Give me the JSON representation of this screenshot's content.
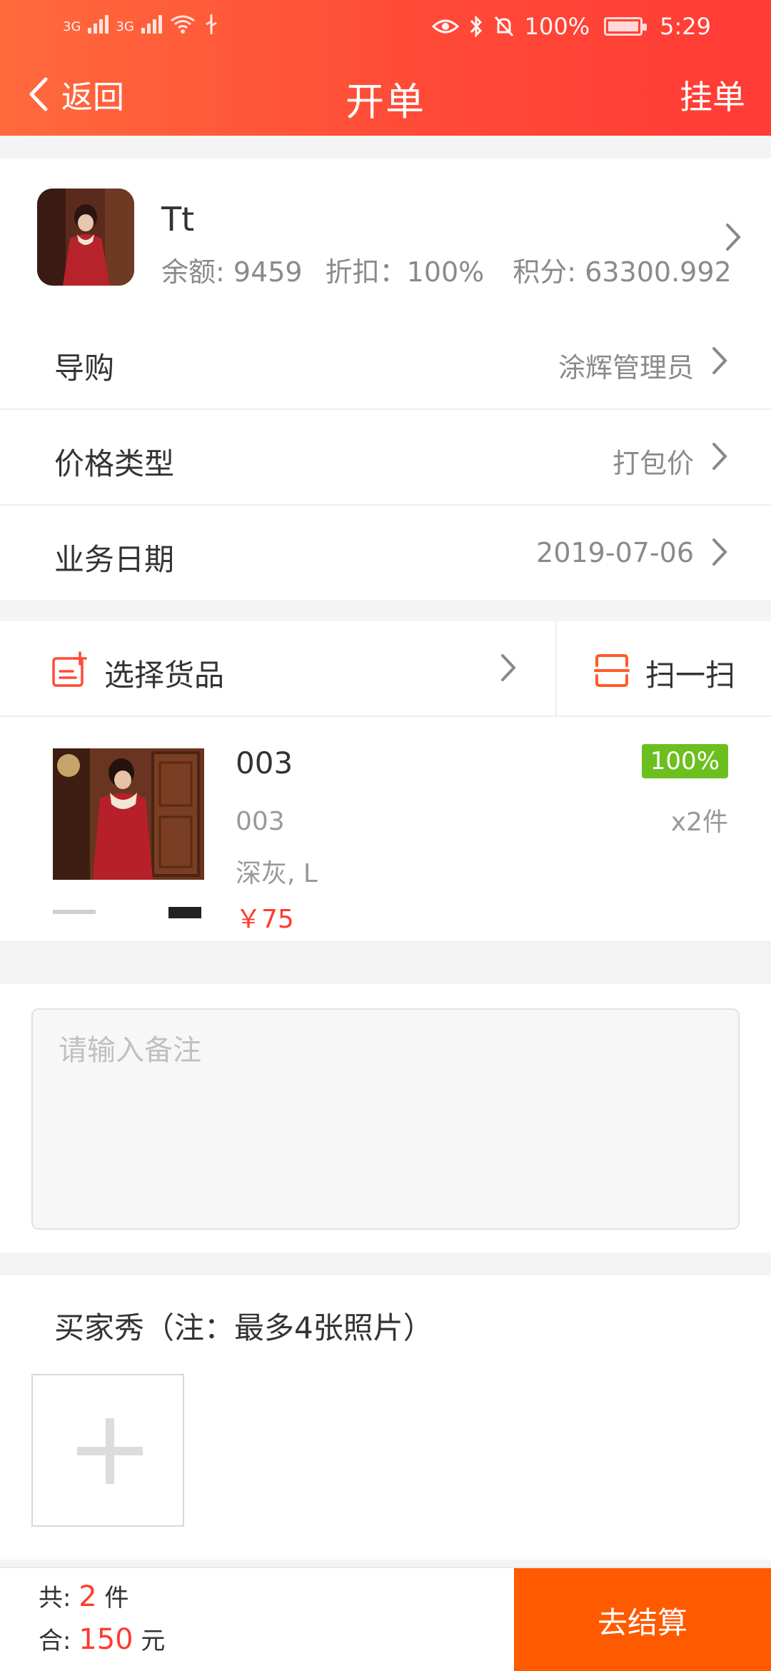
{
  "status_bar": {
    "network_1": "3G",
    "network_2": "3G",
    "battery_percent": "100%",
    "time": "5:29"
  },
  "nav": {
    "back_label": "返回",
    "title": "开单",
    "right_action": "挂单"
  },
  "customer": {
    "name": "Tt",
    "balance_label": "余额:",
    "balance_value": "9459",
    "discount_label": "折扣：",
    "discount_value": "100%",
    "points_label": "积分:",
    "points_value": "63300.992"
  },
  "fields": [
    {
      "label": "导购",
      "value": "涂辉管理员"
    },
    {
      "label": "价格类型",
      "value": "打包价"
    },
    {
      "label": "业务日期",
      "value": "2019-07-06"
    }
  ],
  "product_section": {
    "select_label": "选择货品",
    "scan_label": "扫一扫"
  },
  "product": {
    "name": "003",
    "code": "003",
    "spec": "深灰, L",
    "price": "￥75",
    "discount_badge": "100%",
    "qty": "x2件"
  },
  "remark": {
    "placeholder": "请输入备注"
  },
  "buyer_show": {
    "title": "买家秀（注：最多4张照片）"
  },
  "summary": {
    "count_prefix": "共: ",
    "count_value": "2",
    "count_suffix": " 件",
    "total_prefix": "合: ",
    "total_value": "150",
    "total_suffix": " 元",
    "checkout_label": "去结算"
  },
  "colors": {
    "header_start": "#ff6a3c",
    "header_end": "#ff3b36",
    "accent_red": "#ff3b30",
    "badge_green": "#6bbf1f",
    "checkout_orange": "#ff5a00"
  },
  "icons": [
    "chevron-left-icon",
    "chevron-right-icon",
    "eye-icon",
    "bluetooth-icon",
    "bell-off-icon",
    "battery-icon",
    "wifi-icon",
    "usb-icon",
    "add-goods-icon",
    "scan-icon",
    "plus-icon"
  ]
}
